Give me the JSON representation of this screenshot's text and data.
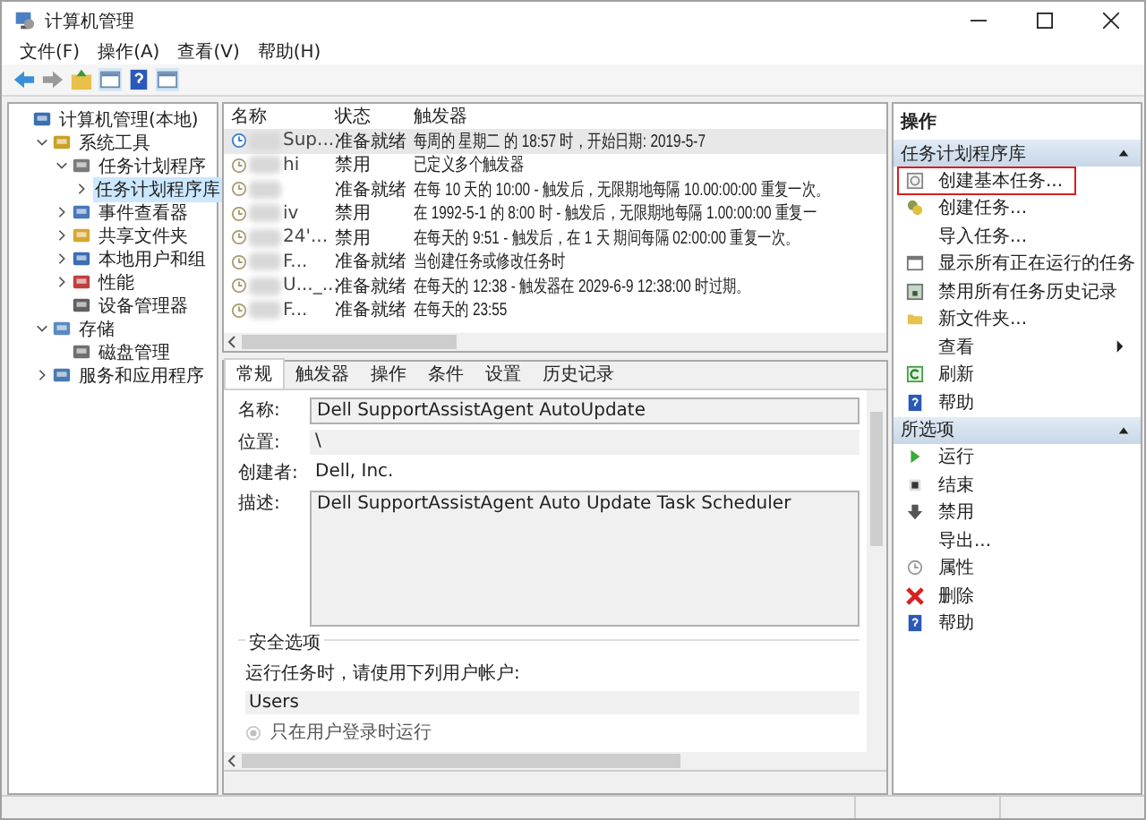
{
  "window": {
    "title": "计算机管理"
  },
  "menu": [
    "文件(F)",
    "操作(A)",
    "查看(V)",
    "帮助(H)"
  ],
  "tree": [
    {
      "label": "计算机管理(本地)",
      "selected": false,
      "children": [
        {
          "label": "系统工具",
          "expanded": true,
          "selected": false,
          "children": [
            {
              "label": "任务计划程序",
              "expanded": true,
              "selected": false,
              "children": [
                {
                  "label": "任务计划程序库",
                  "expanded": false,
                  "selected": true
                }
              ]
            },
            {
              "label": "事件查看器",
              "expanded": false,
              "selected": false
            },
            {
              "label": "共享文件夹",
              "expanded": false,
              "selected": false
            },
            {
              "label": "本地用户和组",
              "expanded": false,
              "selected": false
            },
            {
              "label": "性能",
              "expanded": false,
              "selected": false
            },
            {
              "label": "设备管理器",
              "selected": false
            }
          ]
        },
        {
          "label": "存储",
          "expanded": true,
          "selected": false,
          "children": [
            {
              "label": "磁盘管理",
              "selected": false
            }
          ]
        },
        {
          "label": "服务和应用程序",
          "expanded": false,
          "selected": false
        }
      ]
    }
  ],
  "tasks": {
    "columns": [
      "名称",
      "状态",
      "触发器"
    ],
    "rows": [
      {
        "name": "Sup...",
        "status": "准备就绪",
        "trigger": "每周的 星期二 的 18:57 时，开始日期: 2019-5-7",
        "selected": true
      },
      {
        "name": "hi",
        "status": "禁用",
        "trigger": "已定义多个触发器",
        "selected": false
      },
      {
        "name": "",
        "status": "准备就绪",
        "trigger": "在每 10 天的 10:00 - 触发后，无限期地每隔 10.00:00:00 重复一次。",
        "selected": false
      },
      {
        "name": "iv",
        "status": "禁用",
        "trigger": "在 1992-5-1 的 8:00 时 - 触发后，无限期地每隔 1.00:00:00 重复一",
        "selected": false
      },
      {
        "name": "24'...",
        "status": "禁用",
        "trigger": "在每天的 9:51 - 触发后，在 1 天 期间每隔 02:00:00 重复一次。",
        "selected": false
      },
      {
        "name": "F...",
        "status": "准备就绪",
        "trigger": "当创建任务或修改任务时",
        "selected": false
      },
      {
        "name": "U..._...",
        "status": "准备就绪",
        "trigger": "在每天的 12:38 - 触发器在 2029-6-9 12:38:00 时过期。",
        "selected": false
      },
      {
        "name": "F...",
        "status": "准备就绪",
        "trigger": "在每天的 23:55",
        "selected": false
      }
    ]
  },
  "detail_tabs": [
    {
      "label": "常规",
      "selected": true
    },
    {
      "label": "触发器",
      "selected": false
    },
    {
      "label": "操作",
      "selected": false
    },
    {
      "label": "条件",
      "selected": false
    },
    {
      "label": "设置",
      "selected": false
    },
    {
      "label": "历史记录",
      "selected": false
    }
  ],
  "general": {
    "fields": [
      {
        "label": "名称:",
        "value": "Dell SupportAssistAgent AutoUpdate",
        "kind": "box"
      },
      {
        "label": "位置:",
        "value": "\\",
        "kind": "plain"
      },
      {
        "label": "创建者:",
        "value": "Dell, Inc.",
        "kind": "plain"
      },
      {
        "label": "描述:",
        "value": "Dell SupportAssistAgent Auto Update Task Scheduler",
        "kind": "area"
      }
    ],
    "security": {
      "title": "安全选项",
      "prompt": "运行任务时，请使用下列用户帐户:",
      "account": "Users",
      "options": [
        {
          "label": "只在用户登录时运行",
          "selected": true,
          "disabled": true
        }
      ]
    }
  },
  "actions": {
    "title": "操作",
    "sections": [
      {
        "title": "任务计划程序库",
        "expanded": true,
        "items": [
          {
            "label": "创建基本任务...",
            "highlighted": true
          },
          {
            "label": "创建任务...",
            "highlighted": false
          },
          {
            "label": "导入任务...",
            "highlighted": false
          },
          {
            "label": "显示所有正在运行的任务",
            "highlighted": false
          },
          {
            "label": "禁用所有任务历史记录",
            "highlighted": false
          },
          {
            "label": "新文件夹...",
            "highlighted": false
          },
          {
            "label": "查看",
            "highlighted": false,
            "submenu": true
          },
          {
            "label": "刷新",
            "highlighted": false
          },
          {
            "label": "帮助",
            "highlighted": false
          }
        ]
      },
      {
        "title": "所选项",
        "expanded": true,
        "items": [
          {
            "label": "运行",
            "highlighted": false
          },
          {
            "label": "结束",
            "highlighted": false
          },
          {
            "label": "禁用",
            "highlighted": false
          },
          {
            "label": "导出...",
            "highlighted": false
          },
          {
            "label": "属性",
            "highlighted": false
          },
          {
            "label": "删除",
            "highlighted": false
          },
          {
            "label": "帮助",
            "highlighted": false
          }
        ]
      }
    ]
  }
}
